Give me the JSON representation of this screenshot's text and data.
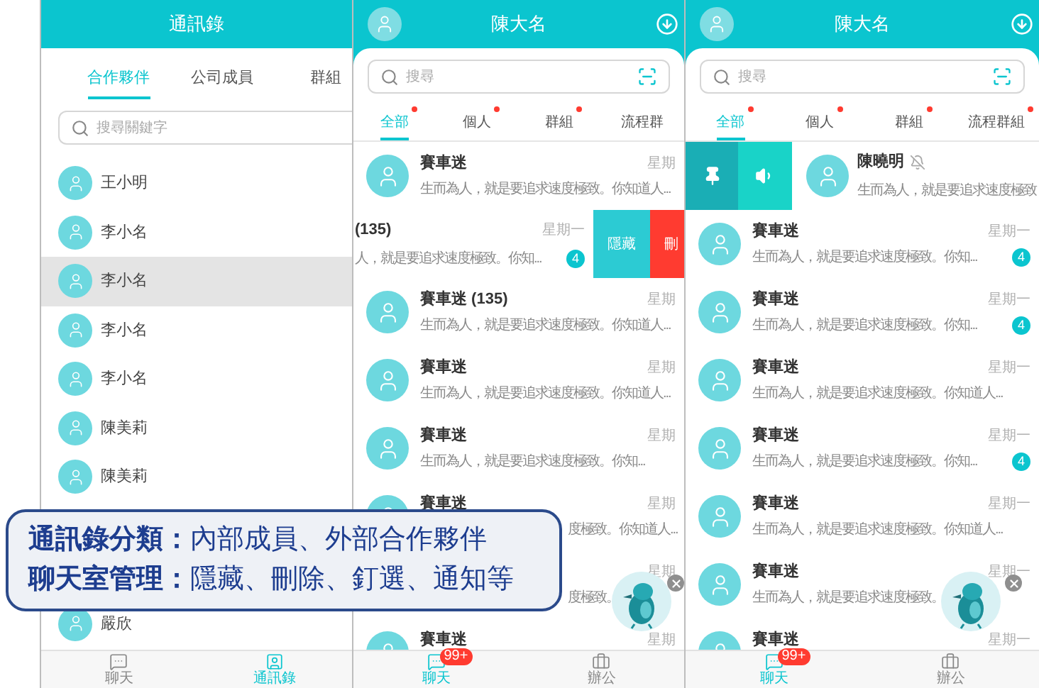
{
  "contacts_screen": {
    "title": "通訊錄",
    "tabs": [
      {
        "label": "合作夥伴",
        "selected": true
      },
      {
        "label": "公司成員",
        "selected": false
      },
      {
        "label": "群組",
        "selected": false
      }
    ],
    "search": {
      "placeholder": "搜尋關鍵字"
    },
    "contacts": [
      {
        "kind": "contact",
        "name": "王小明",
        "highlighted": false
      },
      {
        "kind": "contact",
        "name": "李小名",
        "highlighted": false
      },
      {
        "kind": "contact",
        "name": "李小名",
        "highlighted": true
      },
      {
        "kind": "contact",
        "name": "李小名",
        "highlighted": false
      },
      {
        "kind": "contact",
        "name": "李小名",
        "highlighted": false
      },
      {
        "kind": "contact",
        "name": "陳美莉",
        "highlighted": false
      },
      {
        "kind": "contact",
        "name": "陳美莉",
        "highlighted": false
      },
      {
        "kind": "covered"
      },
      {
        "kind": "covered"
      },
      {
        "kind": "contact",
        "name": "嚴欣",
        "highlighted": false
      }
    ],
    "nav": [
      {
        "label": "聊天",
        "kind": "chat",
        "selected": false
      },
      {
        "label": "通訊錄",
        "kind": "contacts",
        "selected": true
      }
    ]
  },
  "chat_screens": [
    {
      "title": "陳大名",
      "search": {
        "placeholder": "搜尋"
      },
      "tabs": [
        {
          "label": "全部",
          "selected": true,
          "dot": true
        },
        {
          "label": "個人",
          "selected": false,
          "dot": true
        },
        {
          "label": "群組",
          "selected": false,
          "dot": true
        },
        {
          "label": "流程群",
          "selected": false,
          "dot": false
        }
      ],
      "rows": [
        {
          "kind": "chat",
          "name": "賽車迷",
          "preview": "生而為人，就是要追求速度極致。你知道人...",
          "time": "星期"
        },
        {
          "kind": "swiped_left",
          "name": "(135)",
          "preview": "人，就是要追求速度極致。你知...",
          "time": "星期一",
          "badge": "4",
          "actions": [
            {
              "kind": "hide",
              "label": "隱藏"
            },
            {
              "kind": "delete",
              "label": "刪"
            }
          ]
        },
        {
          "kind": "chat",
          "name": "賽車迷 (135)",
          "preview": "生而為人，就是要追求速度極致。你知道人...",
          "time": "星期"
        },
        {
          "kind": "chat",
          "name": "賽車迷",
          "preview": "生而為人，就是要追求速度極致。你知道人...",
          "time": "星期"
        },
        {
          "kind": "chat",
          "name": "賽車迷",
          "preview": "生而為人，就是要追求速度極致。你知...",
          "time": "星期"
        },
        {
          "kind": "covered",
          "name": "賽車迷",
          "preview": "度極致。你知道人...",
          "time": "星期"
        },
        {
          "kind": "covered",
          "preview": "度極致。",
          "time": "星期"
        },
        {
          "kind": "chat",
          "name": "賽車迷",
          "time": "星期"
        }
      ],
      "nav": [
        {
          "label": "聊天",
          "kind": "chat",
          "selected": true,
          "badge": "99+"
        },
        {
          "label": "辦公",
          "kind": "office",
          "selected": false
        }
      ]
    },
    {
      "title": "陳大名",
      "search": {
        "placeholder": "搜尋"
      },
      "tabs": [
        {
          "label": "全部",
          "selected": true,
          "dot": true
        },
        {
          "label": "個人",
          "selected": false,
          "dot": true
        },
        {
          "label": "群組",
          "selected": false,
          "dot": true
        },
        {
          "label": "流程群組",
          "selected": false,
          "dot": true
        }
      ],
      "rows": [
        {
          "kind": "swiped_right",
          "name": "陳曉明",
          "muted": true,
          "preview": "生而為人，就是要追求速度極致",
          "actions": [
            {
              "kind": "pin"
            },
            {
              "kind": "sound"
            }
          ]
        },
        {
          "kind": "chat",
          "name": "賽車迷",
          "preview": "生而為人，就是要追求速度極致。你知...",
          "time": "星期一",
          "badge": "4"
        },
        {
          "kind": "chat",
          "name": "賽車迷",
          "preview": "生而為人，就是要追求速度極致。你知...",
          "time": "星期一",
          "badge": "4"
        },
        {
          "kind": "chat",
          "name": "賽車迷",
          "preview": "生而為人，就是要追求速度極致。你知道人...",
          "time": "星期一"
        },
        {
          "kind": "chat",
          "name": "賽車迷",
          "preview": "生而為人，就是要追求速度極致。你知...",
          "time": "星期一",
          "badge": "4"
        },
        {
          "kind": "chat",
          "name": "賽車迷",
          "preview": "生而為人，就是要追求速度極致。你知道人...",
          "time": "星期一"
        },
        {
          "kind": "chat",
          "name": "賽車迷",
          "preview": "生而為人，就是要追求速度極致。",
          "time": "星期一"
        },
        {
          "kind": "chat",
          "name": "賽車迷",
          "time": "星期一"
        }
      ],
      "nav": [
        {
          "label": "聊天",
          "kind": "chat",
          "selected": true,
          "badge": "99+"
        },
        {
          "label": "辦公",
          "kind": "office",
          "selected": false
        }
      ]
    }
  ],
  "callout": {
    "lines": [
      "**通訊錄分類：**內部成員、外部合作夥伴",
      "**聊天室管理：**隱藏、刪除、釘選、通知等"
    ]
  }
}
